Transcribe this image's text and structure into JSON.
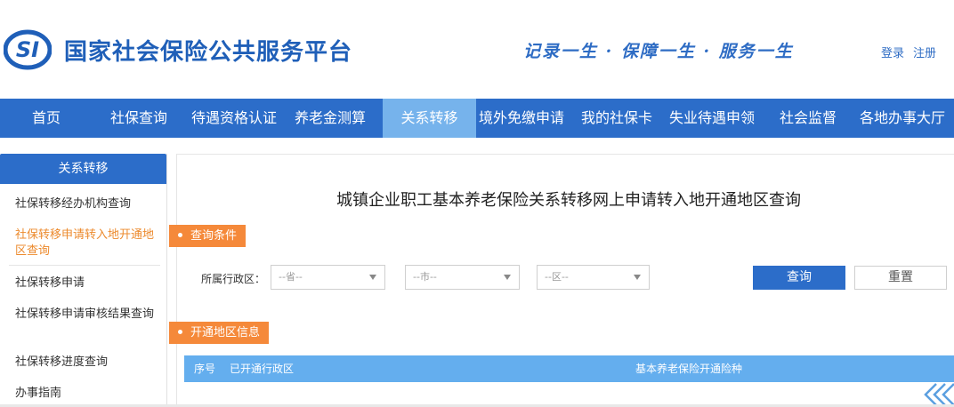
{
  "header": {
    "logo_text": "SI",
    "site_title": "国家社会保险公共服务平台",
    "slogan": "记录一生 · 保障一生 · 服务一生",
    "login_label": "登录",
    "register_label": "注册",
    "brand_color": "#1f5fb8"
  },
  "nav": {
    "items": [
      {
        "label": "首页"
      },
      {
        "label": "社保查询"
      },
      {
        "label": "待遇资格认证"
      },
      {
        "label": "养老金测算"
      },
      {
        "label": "关系转移",
        "active": true
      },
      {
        "label": "境外免缴申请"
      },
      {
        "label": "我的社保卡"
      },
      {
        "label": "失业待遇申领"
      },
      {
        "label": "社会监督"
      },
      {
        "label": "各地办事大厅"
      }
    ],
    "bg_color": "#2c6dc9",
    "active_color": "#76b3ec"
  },
  "sidebar": {
    "title": "关系转移",
    "items": [
      {
        "label": "社保转移经办机构查询"
      },
      {
        "label": "社保转移申请转入地开通地区查询",
        "active": true
      },
      {
        "label": "社保转移申请"
      },
      {
        "label": "社保转移申请审核结果查询"
      },
      {
        "label": "社保转移进度查询"
      },
      {
        "label": "办事指南"
      }
    ],
    "active_color": "#ec8a2d"
  },
  "main": {
    "page_title": "城镇企业职工基本养老保险关系转移网上申请转入地开通地区查询",
    "query_section_label": "查询条件",
    "region_label": "所属行政区：",
    "province_placeholder": "--省--",
    "city_placeholder": "--市--",
    "district_placeholder": "--区--",
    "query_button": "查询",
    "reset_button": "重置",
    "info_section_label": "开通地区信息",
    "table_columns": [
      "序号",
      "已开通行政区",
      "基本养老保险开通险种"
    ],
    "table_rows": [],
    "accent_color": "#f5893a"
  }
}
